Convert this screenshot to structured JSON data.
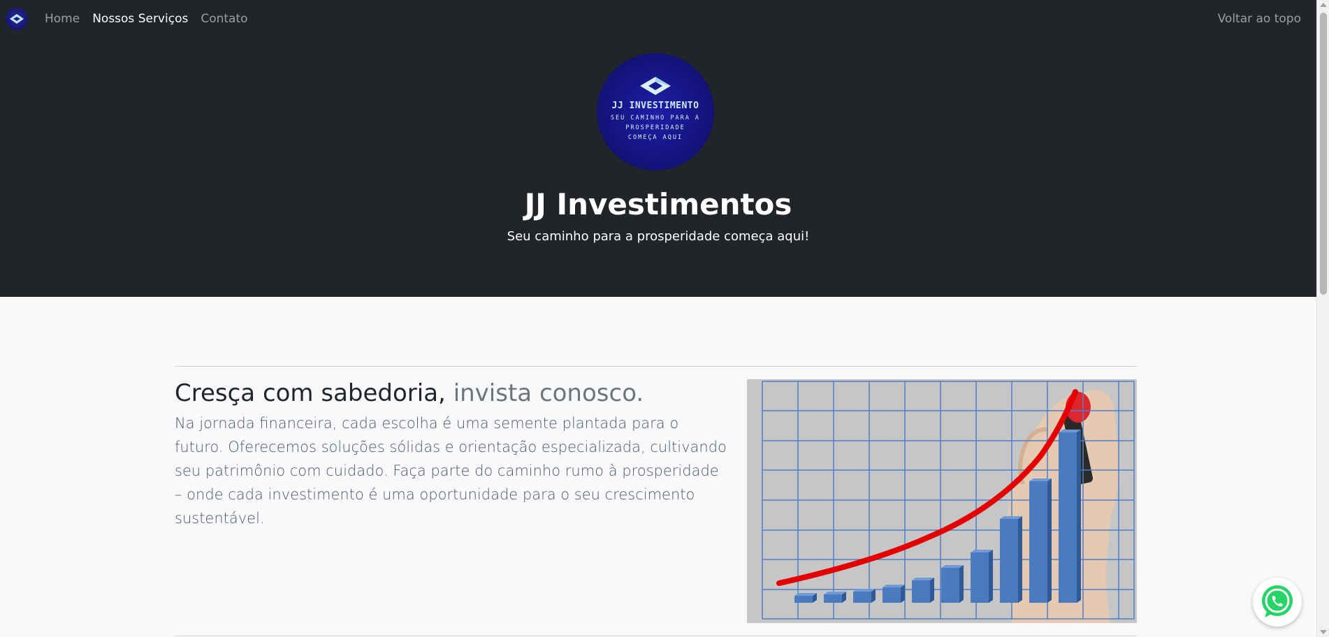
{
  "nav": {
    "logo_icon": "jj-logo-icon",
    "links": [
      {
        "label": "Home"
      },
      {
        "label": "Nossos Serviços"
      },
      {
        "label": "Contato"
      }
    ],
    "back_to_top": "Voltar ao topo"
  },
  "hero": {
    "logo_name": "JJ INVESTIMENTO",
    "logo_tagline": "SEU CAMINHO PARA A PROSPERIDADE COMEÇA AQUI",
    "title": "JJ Investimentos",
    "subtitle": "Seu caminho para a prosperidade começa aqui!"
  },
  "feature": {
    "heading_main": "Cresça com sabedoria,",
    "heading_muted": "invista conosco.",
    "text": "Na jornada financeira, cada escolha é uma semente plantada para o futuro. Oferecemos soluções sólidas e orientação especializada, cultivando seu patrimônio com cuidado. Faça parte do caminho rumo à prosperidade – onde cada investimento é uma oportunidade para o seu crescimento sustentável.",
    "image_icon": "growth-chart-illustration"
  },
  "floating": {
    "whatsapp_icon": "whatsapp-icon"
  },
  "colors": {
    "navbar_bg": "#212529",
    "page_bg": "#f8f9fa",
    "accent_bar": "#4a7bbf",
    "accent_line": "#e30000",
    "whatsapp_green": "#25d366"
  }
}
